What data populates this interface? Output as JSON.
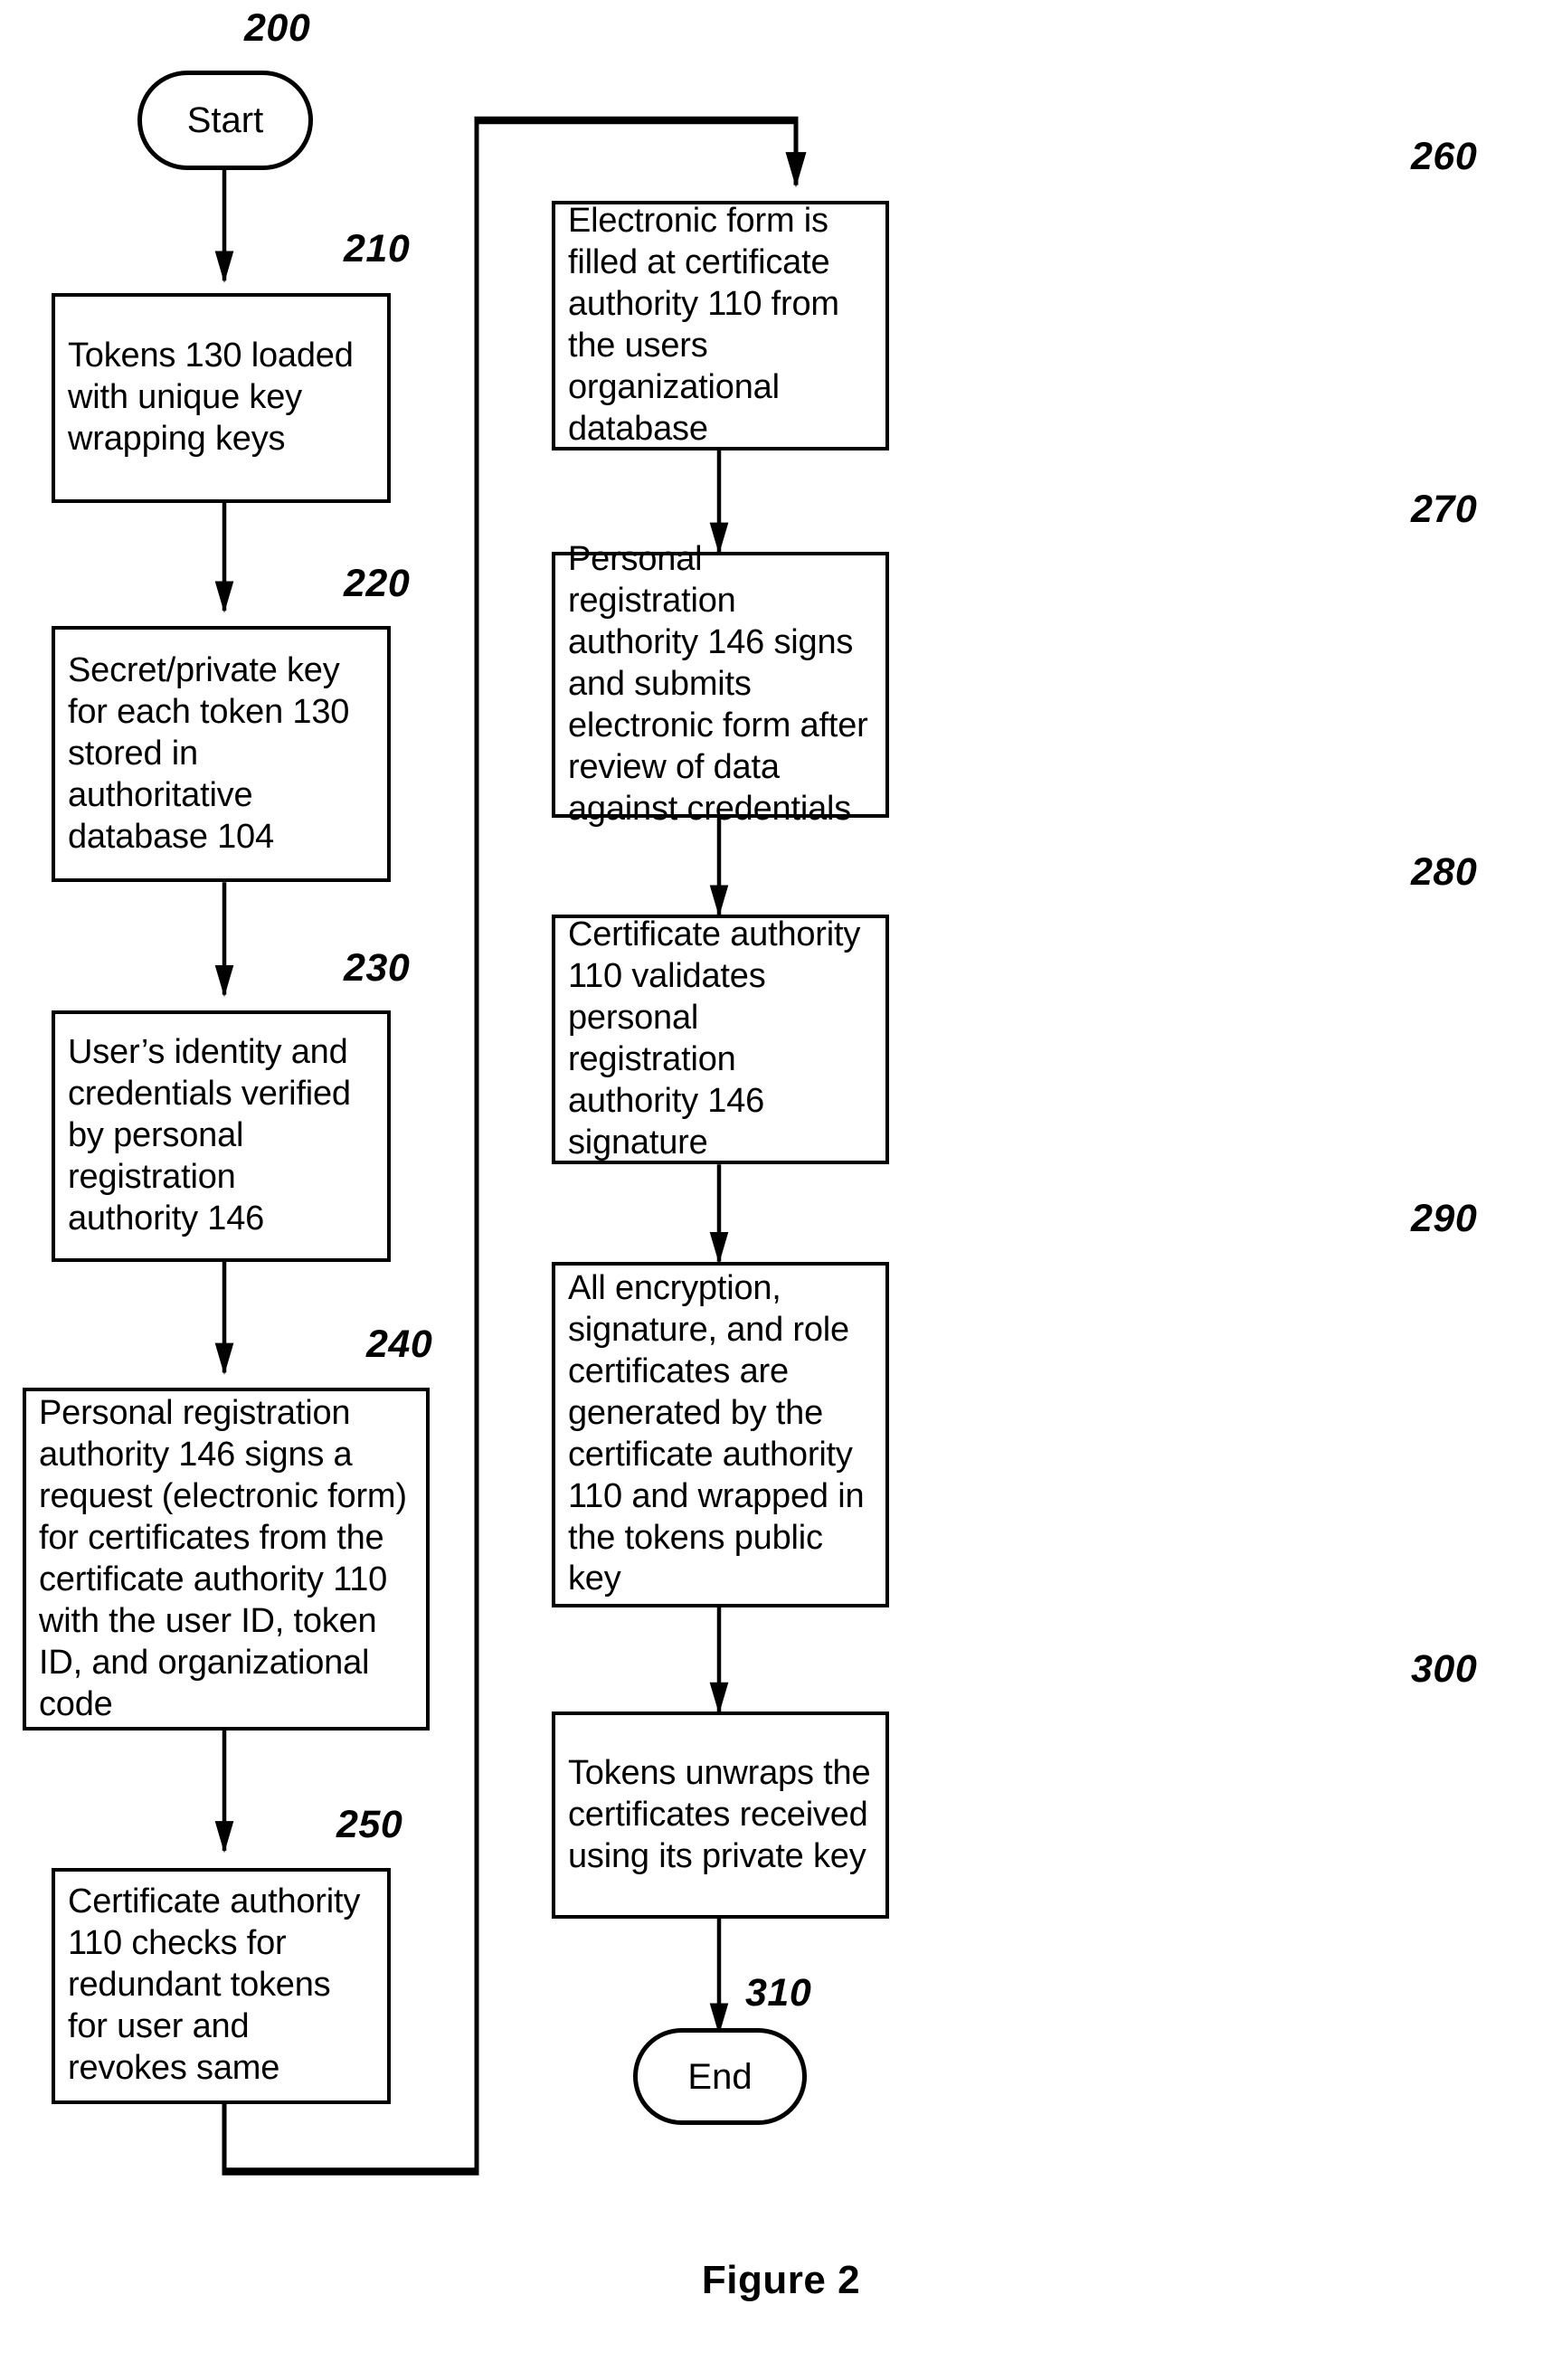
{
  "figure": {
    "caption": "Figure 2"
  },
  "terminators": [
    {
      "id": "start",
      "ref": "200",
      "label": "Start"
    },
    {
      "id": "end",
      "ref": "310",
      "label": "End"
    }
  ],
  "steps": [
    {
      "ref": "210",
      "text": "Tokens 130 loaded with unique key wrapping keys"
    },
    {
      "ref": "220",
      "text": "Secret/private key for each token 130 stored in authoritative database 104"
    },
    {
      "ref": "230",
      "text": "User’s identity and credentials verified by personal registration authority 146"
    },
    {
      "ref": "240",
      "text": "Personal registration authority 146 signs a request (electronic form) for certificates from the certificate authority 110 with the user ID, token ID, and organizational code"
    },
    {
      "ref": "250",
      "text": "Certificate authority 110 checks for redundant tokens for user and revokes same"
    },
    {
      "ref": "260",
      "text": "Electronic form is filled at certificate authority 110 from the users organizational database"
    },
    {
      "ref": "270",
      "text": "Personal registration authority 146 signs and submits electronic form after review of data against credentials"
    },
    {
      "ref": "280",
      "text": "Certificate authority 110 validates personal registration authority 146 signature"
    },
    {
      "ref": "290",
      "text": "All encryption, signature, and role certificates are generated by the certificate authority 110 and wrapped in the tokens public key"
    },
    {
      "ref": "300",
      "text": "Tokens unwraps the certificates received using its private key"
    }
  ],
  "colors": {
    "ink": "#000000",
    "paper": "#ffffff"
  }
}
